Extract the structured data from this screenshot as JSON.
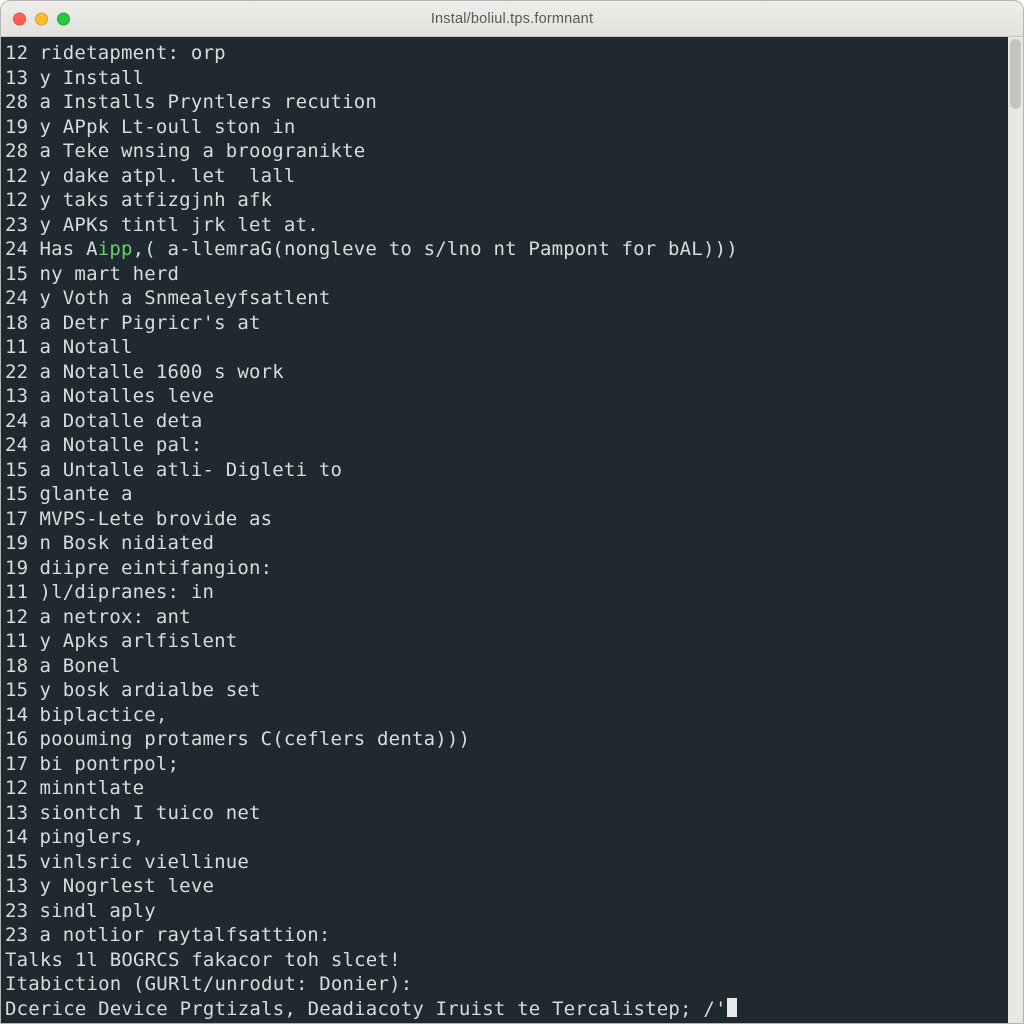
{
  "window": {
    "title": "Instal/boliul.tps.formnant"
  },
  "colors": {
    "terminal_bg": "#1e2a30",
    "terminal_fg": "#d9dcdc",
    "accent_green": "#6dcf6a",
    "titlebar_from": "#efedea",
    "titlebar_to": "#e3e1de"
  },
  "lines": [
    {
      "num": "12",
      "text": "ridetapment: orp"
    },
    {
      "num": "13",
      "text": "y Install"
    },
    {
      "num": "28",
      "text": "a Installs Pryntlers recution"
    },
    {
      "num": "19",
      "text": "y APpk Lt-oull ston in"
    },
    {
      "num": "28",
      "text": "a Teke wnsing a broogranikte"
    },
    {
      "num": "12",
      "text": "y dake atpl. let  lall"
    },
    {
      "num": "12",
      "text": "y taks atfizgjnh afk"
    },
    {
      "num": "23",
      "text": "y APKs tintl jrk let at."
    },
    {
      "num": "24",
      "pre": "Has A",
      "grn": "ipp",
      "post": ",( a-llemraG(nongleve to s/lno nt Pampont for bAL)))"
    },
    {
      "num": "15",
      "text": "ny mart herd"
    },
    {
      "num": "24",
      "text": "y Voth a Snmealeyfsatlent"
    },
    {
      "num": "18",
      "text": "a Detr Pigricr's at"
    },
    {
      "num": "11",
      "text": "a Notall"
    },
    {
      "num": "22",
      "text": "a Notalle 1600 s work"
    },
    {
      "num": "13",
      "text": "a Notalles leve"
    },
    {
      "num": "24",
      "text": "a Dotalle deta"
    },
    {
      "num": "24",
      "text": "a Notalle pal:"
    },
    {
      "num": "15",
      "text": "a Untalle atli- Digleti to"
    },
    {
      "num": "15",
      "text": "glante a"
    },
    {
      "num": "17",
      "text": "MVPS-Lete brovide as"
    },
    {
      "num": "19",
      "text": "n Bosk nidiated"
    },
    {
      "num": "19",
      "text": "diipre eintifangion:"
    },
    {
      "num": "11",
      "text": ")l/dipranes: in"
    },
    {
      "num": "12",
      "text": "a netrox: ant"
    },
    {
      "num": "11",
      "text": "y Apks arlfislent"
    },
    {
      "num": "18",
      "text": "a Bonel"
    },
    {
      "num": "15",
      "text": "y bosk ardialbe set"
    },
    {
      "num": "14",
      "text": "biplactice,"
    },
    {
      "num": "16",
      "text": "poouming protamers C(ceflers denta)))"
    },
    {
      "num": "17",
      "text": "bi pontrpol;"
    },
    {
      "num": "12",
      "text": "minntlate"
    },
    {
      "num": "13",
      "text": "siontch I tuico net"
    },
    {
      "num": "14",
      "text": "pinglers,"
    },
    {
      "num": "15",
      "text": "vinlsric viellinue"
    },
    {
      "num": "13",
      "text": "y Nogrlest leve"
    },
    {
      "num": "23",
      "text": "sindl aply"
    },
    {
      "num": "23",
      "text": "a notlior raytalfsattion:"
    }
  ],
  "tail": {
    "l1": "Talks 1l BOGRCS fakacor toh slcet!",
    "l2": "Itabiction (GURlt/unrodut: Donier):",
    "l3_pre": "Dcerice Device Prgtizals, Deadiacoty Iruist te Tercalistep; /'",
    "l3_post": ""
  }
}
